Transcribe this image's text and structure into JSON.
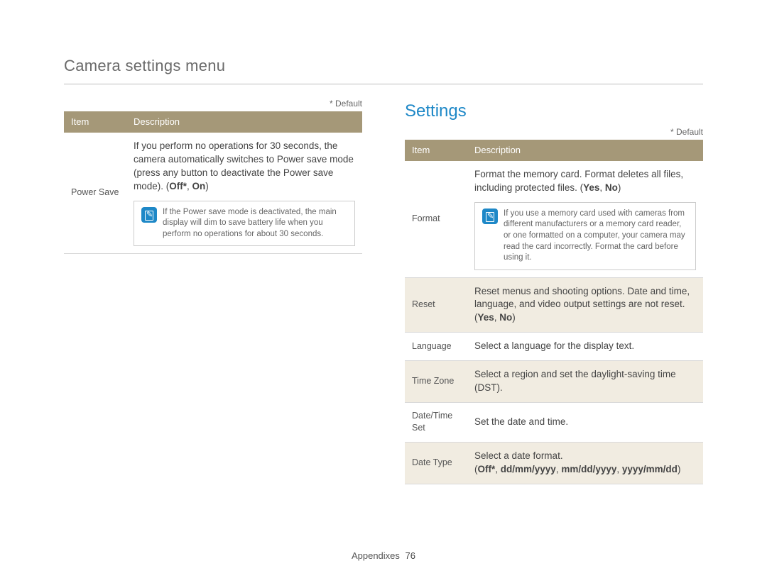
{
  "page_title": "Camera settings menu",
  "default_note": "* Default",
  "headers": {
    "item": "Item",
    "description": "Description"
  },
  "settings_heading": "Settings",
  "left_rows": [
    {
      "item": "Power Save",
      "desc_pre": "If you perform no operations for 30 seconds, the camera automatically switches to Power save mode (press any button to deactivate the Power save mode). (",
      "opts": [
        "Off*",
        "On"
      ],
      "desc_post": ")",
      "note": "If the Power save mode is deactivated, the main display will dim to save battery life when you perform no operations for about 30 seconds."
    }
  ],
  "right_rows": [
    {
      "item": "Format",
      "desc_pre": "Format the memory card. Format deletes all files, including protected files. (",
      "opts": [
        "Yes",
        "No"
      ],
      "desc_post": ")",
      "note": "If you use a memory card used with cameras from different manufacturers or a memory card reader, or one formatted on a computer, your camera may read the card incorrectly. Format the card before using it."
    },
    {
      "item": "Reset",
      "desc_pre": "Reset menus and shooting options. Date and time, language, and video output settings are not reset. (",
      "opts": [
        "Yes",
        "No"
      ],
      "desc_post": ")",
      "alt": true
    },
    {
      "item": "Language",
      "desc_plain": "Select a language for the display text."
    },
    {
      "item": "Time Zone",
      "desc_plain": "Select a region and set the daylight-saving time (DST).",
      "alt": true
    },
    {
      "item": "Date/Time Set",
      "desc_plain": "Set the date and time."
    },
    {
      "item": "Date Type",
      "desc_pre": "Select a date format.\n(",
      "opts": [
        "Off*",
        "dd/mm/yyyy",
        "mm/dd/yyyy",
        "yyyy/mm/dd"
      ],
      "desc_post": ")",
      "alt": true
    }
  ],
  "footer": {
    "label": "Appendixes",
    "page": "76"
  }
}
